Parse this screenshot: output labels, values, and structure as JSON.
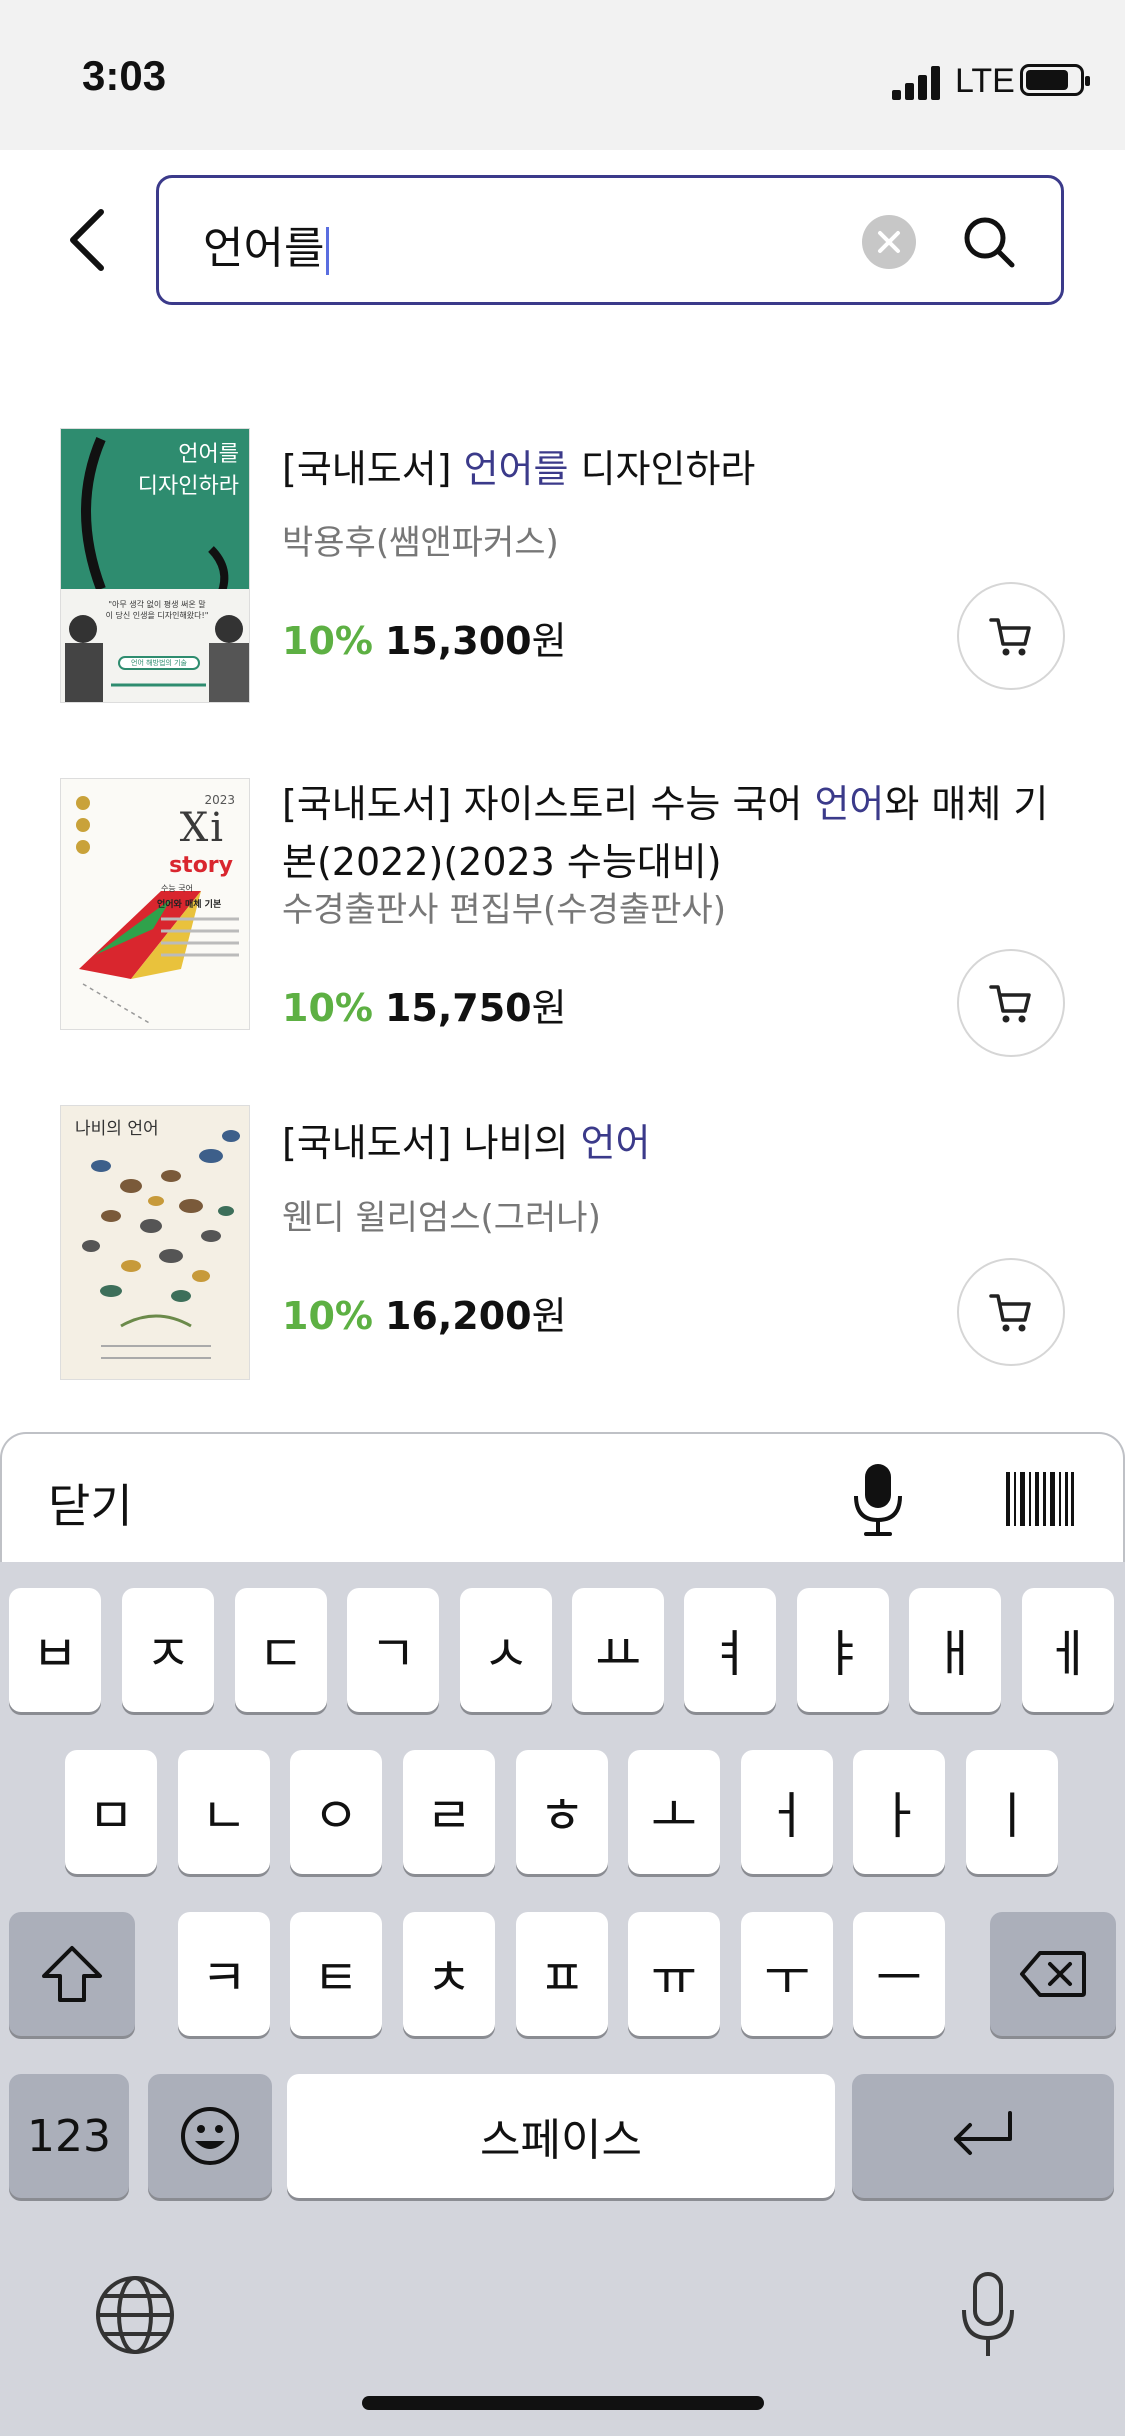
{
  "status_bar": {
    "time": "3:03",
    "network": "LTE"
  },
  "search": {
    "query": "언어를"
  },
  "results": [
    {
      "category": "[국내도서]",
      "title_before": " ",
      "highlight": "언어를",
      "title_after": " 디자인하라",
      "author": "박용후(쌤앤파커스)",
      "discount": "10%",
      "price": "15,300",
      "currency": "원",
      "cover": {
        "title": "언어를\n디자인하라",
        "quote": "\"아무 생각 없이 평생 써온 말이 당신 인생을 디자인해왔다!\"",
        "badge": "언어 해방법의 기술"
      }
    },
    {
      "category": "[국내도서]",
      "title_before": " 자이스토리 수능 국어 ",
      "highlight": "언어",
      "title_after": "와 매체 기본(2022)(2023 수능대비)",
      "author": "수경출판사 편집부(수경출판사)",
      "discount": "10%",
      "price": "15,750",
      "currency": "원",
      "cover": {
        "year": "2023",
        "brand": "Xi",
        "sub": "story",
        "subject": "수능 국어",
        "name": "언어와 매체 기본"
      }
    },
    {
      "category": "[국내도서]",
      "title_before": " 나비의 ",
      "highlight": "언어",
      "title_after": "",
      "author": "웬디 윌리엄스(그러나)",
      "discount": "10%",
      "price": "16,200",
      "currency": "원",
      "cover": {
        "title": "나비의 언어"
      }
    }
  ],
  "accessory": {
    "close": "닫기"
  },
  "keyboard": {
    "row1": [
      "ㅂ",
      "ㅈ",
      "ㄷ",
      "ㄱ",
      "ㅅ",
      "ㅛ",
      "ㅕ",
      "ㅑ",
      "ㅐ",
      "ㅔ"
    ],
    "row2": [
      "ㅁ",
      "ㄴ",
      "ㅇ",
      "ㄹ",
      "ㅎ",
      "ㅗ",
      "ㅓ",
      "ㅏ",
      "ㅣ"
    ],
    "row3": [
      "ㅋ",
      "ㅌ",
      "ㅊ",
      "ㅍ",
      "ㅠ",
      "ㅜ",
      "ㅡ"
    ],
    "numbers_key": "123",
    "space_key": "스페이스"
  },
  "colors": {
    "brand": "#3b3a8a",
    "discount": "#5db043",
    "keyboard_bg": "#d3d5dc"
  },
  "icons": [
    "back-icon",
    "clear-icon",
    "search-icon",
    "cart-icon",
    "mic-icon",
    "barcode-icon",
    "shift-icon",
    "backspace-icon",
    "emoji-icon",
    "return-icon",
    "globe-icon"
  ]
}
